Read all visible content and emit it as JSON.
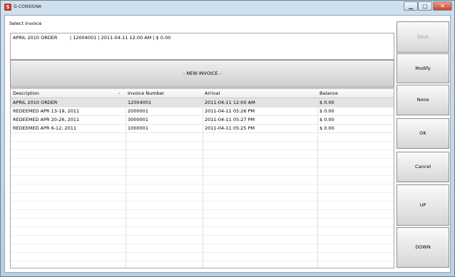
{
  "window": {
    "title": "G-CONSIGNA",
    "app_icon_letter": "S"
  },
  "select_label": "Select Invoice",
  "selected": {
    "description": "APRIL 2010 ORDER",
    "details": "| 12004001 | 2011-04-11 12:00 AM | $  0.00"
  },
  "new_invoice_label": "- NEW INVOICE -",
  "grid": {
    "columns": [
      "Description",
      "Invoice Number",
      "Arrival",
      "Balance"
    ],
    "rows": [
      {
        "description": "APRIL 2010 ORDER",
        "invoice": "12004001",
        "arrival": "2011-04-11 12:00 AM",
        "balance": "$  0.00"
      },
      {
        "description": "REDEEMED APR 13-19, 2011",
        "invoice": "2000001",
        "arrival": "2011-04-11 05:26 PM",
        "balance": "$  0.00"
      },
      {
        "description": "REDEEMED APR 20-26, 2011",
        "invoice": "3000001",
        "arrival": "2011-04-11 05:27 PM",
        "balance": "$  0.00"
      },
      {
        "description": "REDEEMED APR 6-12, 2011",
        "invoice": "1000001",
        "arrival": "2011-04-11 05:25 PM",
        "balance": "$  0.00"
      }
    ]
  },
  "side_buttons": {
    "stick": "Stick",
    "modify": "Modify",
    "none": "None",
    "ok": "OK",
    "cancel": "Cancel",
    "up": "UP",
    "down": "DOWN"
  }
}
